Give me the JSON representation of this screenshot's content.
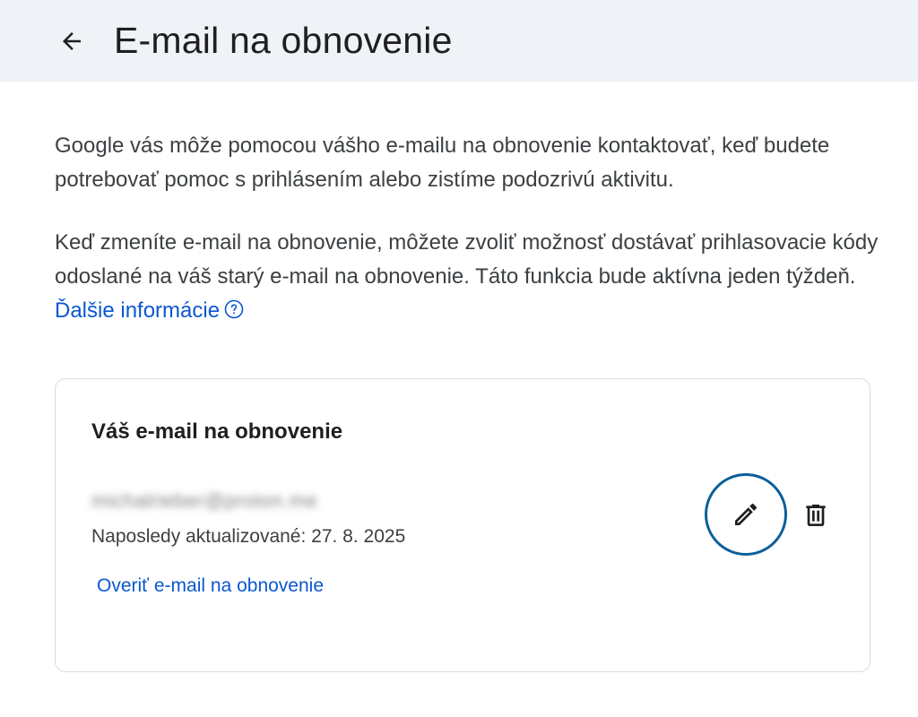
{
  "header": {
    "back_icon": "arrow-back-icon",
    "title": "E-mail na obnovenie"
  },
  "intro": {
    "paragraph1": "Google vás môže pomocou vášho e-mailu na obnovenie kontaktovať, keď budete potrebovať pomoc s prihlásením alebo zistíme podozrivú aktivitu.",
    "paragraph2": "Keď zmeníte e-mail na obnovenie, môžete zvoliť možnosť dostávať prihlasovacie kódy odoslané na váš starý e-mail na obnovenie. Táto funkcia bude aktívna jeden týždeň. ",
    "learn_more_link": "Ďalšie informácie",
    "help_icon": "help-circle-icon"
  },
  "card": {
    "title": "Váš e-mail na obnovenie",
    "email_redacted": "michalrieber@proton.me",
    "last_updated": "Naposledy aktualizované: 27. 8. 2025",
    "verify_link": "Overiť e-mail na obnovenie",
    "edit_icon": "pencil-icon",
    "delete_icon": "trash-icon"
  },
  "colors": {
    "header_bg": "#eff2f6",
    "link": "#0b57d0",
    "focus_ring": "#0b5f99",
    "card_border": "#dadce0"
  }
}
